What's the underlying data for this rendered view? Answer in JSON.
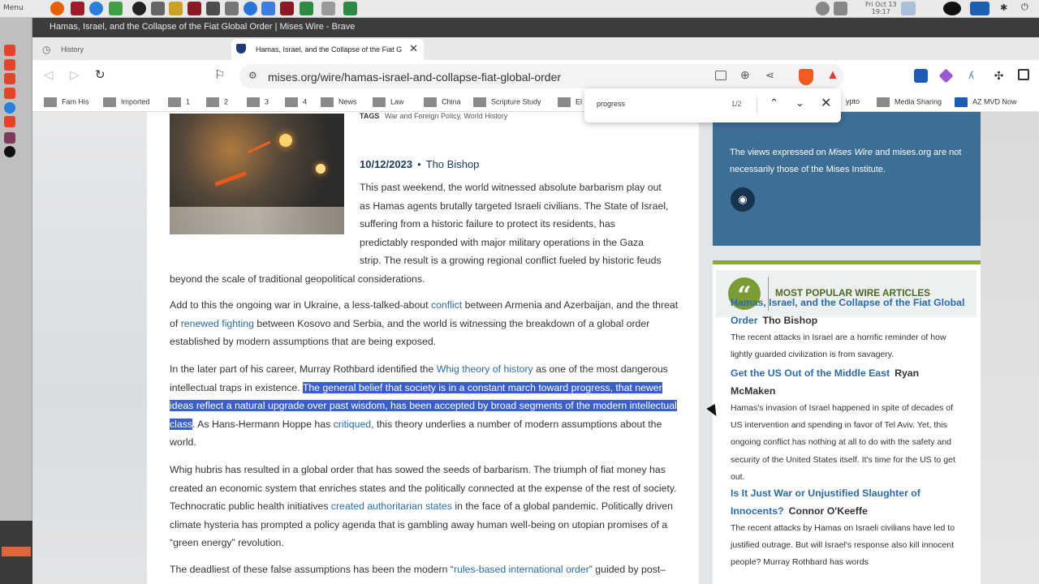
{
  "os": {
    "menu_label": "Menu",
    "clock_line1": "Fri Oct 13",
    "clock_line2": "19:17"
  },
  "browser": {
    "window_title": "Hamas, Israel, and the Collapse of the Fiat Global Order | Mises Wire - Brave",
    "tabs": [
      {
        "label": "History"
      },
      {
        "label": "Hamas, Israel, and the Collapse of the Fiat Global Order | Mises Wire"
      }
    ],
    "url": "mises.org/wire/hamas-israel-and-collapse-fiat-global-order",
    "bookmarks": [
      "Fam His",
      "Imported",
      "1",
      "2",
      "3",
      "4",
      "News",
      "Law",
      "China",
      "Scripture Study",
      "El",
      "ypto",
      "Media Sharing",
      "AZ MVD Now"
    ],
    "find": {
      "query": "progress",
      "count": "1/2"
    }
  },
  "article": {
    "tags_label": "TAGS",
    "tags": "War and Foreign Policy, World History",
    "date": "10/12/2023",
    "author": "Tho Bishop",
    "p1": "This past weekend, the world witnessed absolute barbarism play out as Hamas agents brutally targeted Israeli civilians. The State of Israel, suffering from a historic failure to protect its residents, has predictably responded with major military operations in the Gaza strip. The result is a growing regional conflict fueled by historic feuds beyond the scale of traditional geopolitical considerations.",
    "p1_l1": "This past weekend, the world witnessed absolute barbarism play out",
    "p1_l2": "as Hamas agents brutally targeted Israeli civilians. The State of Israel,",
    "p1_l3": "suffering from a historic failure to protect its residents, has",
    "p1_l4": "predictably responded with major military operations in the Gaza",
    "p1_l5": "strip. The result is a growing regional conflict fueled by historic feuds",
    "p1_l6": "beyond the scale of traditional geopolitical considerations.",
    "p2_a": "Add to this the ongoing war in Ukraine, a less-talked-about ",
    "p2_link1": "conflict",
    "p2_b": " between Armenia and Azerbaijan, and the threat of ",
    "p2_link2": "renewed fighting",
    "p2_c": " between Kosovo and Serbia, and the world is witnessing the breakdown of a global order established by modern assumptions that are being exposed.",
    "p3_a": "In the later part of his career, Murray Rothbard identified the ",
    "p3_link1": "Whig theory of history",
    "p3_b": " as one of the most dangerous intellectual traps in existence. ",
    "p3_highlight": "The general belief that society is in a constant march toward progress, that newer ideas reflect a natural upgrade over past wisdom, has been accepted by broad segments of the modern intellectual class",
    "p3_c": ". As Hans-Hermann Hoppe has ",
    "p3_link2": "critiqued",
    "p3_d": ", this theory underlies a number of modern assumptions about the world.",
    "p4_a": "Whig hubris has resulted in a global order that has sowed the seeds of barbarism. The triumph of fiat money has created an economic system that enriches states and the politically connected at the expense of the rest of society. Technocratic public health initiatives ",
    "p4_link1": "created authoritarian states",
    "p4_b": " in the face of a global pandemic. Politically driven climate hysteria has prompted a policy agenda that is gambling away human well-being on utopian promises of a “green energy” revolution.",
    "p5_a": "The deadliest of these false assumptions has been the modern “",
    "p5_link1": "rules-based international order",
    "p5_b": "” guided by post–Cold War US hegemony. The triumph of “liberal democracy” over the Soviet Union fueled the hubris of"
  },
  "sidebar": {
    "views_a": "The views expressed on ",
    "views_em": "Mises Wire",
    "views_b": " and mises.org are not necessarily those of the Mises Institute.",
    "popular_title": "MOST POPULAR WIRE ARTICLES",
    "items": [
      {
        "title": "Hamas, Israel, and the Collapse of the Fiat Global Order",
        "author": "Tho Bishop",
        "summary": "The recent attacks in Israel are a horrific reminder of how lightly guarded civilization is from savagery."
      },
      {
        "title": "Get the US Out of the Middle East",
        "author": "Ryan McMaken",
        "summary": "Hamas's invasion of Israel happened in spite of decades of US intervention and spending in favor of Tel Aviv. Yet, this ongoing conflict has nothing at all to do with the safety and security of the United States itself. It's time for the US to get out."
      },
      {
        "title": "Is It Just War or Unjustified Slaughter of Innocents?",
        "author": "Connor O'Keeffe",
        "summary": "The recent attacks by Hamas on Israeli civilians have led to justified outrage. But will Israel's response also kill innocent people? Murray Rothbard has words"
      }
    ]
  },
  "colors": {
    "link": "#2a6ba8",
    "highlight": "#3b5fc9",
    "sidebar_blue": "#3d6e96",
    "accent_green": "#7b9b35"
  },
  "icons": [
    "menu-icon",
    "firefox-icon",
    "brave-icon",
    "back-icon",
    "forward-icon",
    "reload-icon",
    "bookmark-icon",
    "tune-icon",
    "reader-icon",
    "zoom-icon",
    "share-icon",
    "brave-shield-icon",
    "rewards-icon",
    "rss-icon",
    "quote-icon",
    "chevron-up-icon",
    "chevron-down-icon",
    "close-icon",
    "folder-icon"
  ]
}
